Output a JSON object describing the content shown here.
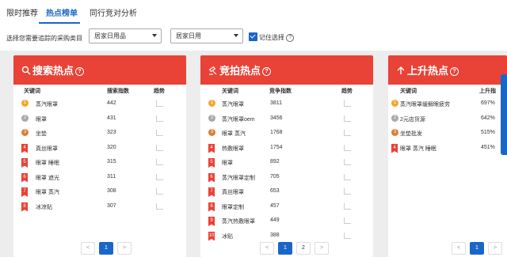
{
  "tabs": [
    {
      "label": "限时推荐"
    },
    {
      "label": "热点榜单"
    },
    {
      "label": "同行竞对分析"
    }
  ],
  "filter": {
    "label": "选择您需要追踪的采购类目",
    "category1": "居家日用品",
    "category2": "居家日用",
    "remember_label": "记住选择",
    "help": "?"
  },
  "panels": [
    {
      "title": "搜索热点",
      "icon": "search-icon",
      "columns": [
        "关键词",
        "搜索指数",
        "趋势"
      ],
      "rows": [
        {
          "rank": "1",
          "keyword": "蒸汽眼罩",
          "value": "442"
        },
        {
          "rank": "2",
          "keyword": "眼罩",
          "value": "431"
        },
        {
          "rank": "3",
          "keyword": "坐垫",
          "value": "323"
        },
        {
          "rank": "4",
          "keyword": "真丝眼罩",
          "value": "320"
        },
        {
          "rank": "5",
          "keyword": "眼罩 睡眠",
          "value": "315"
        },
        {
          "rank": "6",
          "keyword": "眼罩 遮光",
          "value": "311"
        },
        {
          "rank": "7",
          "keyword": "眼罩 蒸汽",
          "value": "308"
        },
        {
          "rank": "8",
          "keyword": "冰凉贴",
          "value": "307"
        }
      ],
      "pager": [
        "<",
        "1",
        ">"
      ]
    },
    {
      "title": "竞拍热点",
      "icon": "gavel-icon",
      "columns": [
        "关键词",
        "竞争指数",
        "趋势"
      ],
      "rows": [
        {
          "rank": "1",
          "keyword": "蒸汽眼罩",
          "value": "3811"
        },
        {
          "rank": "2",
          "keyword": "蒸汽眼罩oem",
          "value": "3456"
        },
        {
          "rank": "3",
          "keyword": "眼罩 蒸汽",
          "value": "1768"
        },
        {
          "rank": "4",
          "keyword": "热敷眼罩",
          "value": "1754"
        },
        {
          "rank": "5",
          "keyword": "眼罩",
          "value": "892"
        },
        {
          "rank": "6",
          "keyword": "蒸汽眼罩定制",
          "value": "705"
        },
        {
          "rank": "7",
          "keyword": "真丝眼罩",
          "value": "653"
        },
        {
          "rank": "8",
          "keyword": "眼罩定制",
          "value": "457"
        },
        {
          "rank": "9",
          "keyword": "蒸汽热敷眼罩",
          "value": "449"
        },
        {
          "rank": "10",
          "keyword": "冰贴",
          "value": "388"
        }
      ],
      "pager": [
        "<",
        "1",
        "2",
        ">"
      ]
    },
    {
      "title": "上升热点",
      "icon": "arrow-up-icon",
      "columns": [
        "关键词",
        "上升指"
      ],
      "rows": [
        {
          "rank": "1",
          "keyword": "蒸汽眼罩缓解眼疲劳",
          "value": "697%"
        },
        {
          "rank": "2",
          "keyword": "2元店货源",
          "value": "642%"
        },
        {
          "rank": "3",
          "keyword": "坐垫批发",
          "value": "515%"
        },
        {
          "rank": "4",
          "keyword": "眼罩 蒸汽 睡眠",
          "value": "451%"
        }
      ],
      "pager": [
        "<",
        "1",
        ">"
      ]
    }
  ],
  "colors": {
    "accent": "#1a66c7",
    "header_red": "#e94236",
    "gold": "#f0a830",
    "silver": "#a9a9a9",
    "bronze": "#e07b39"
  }
}
